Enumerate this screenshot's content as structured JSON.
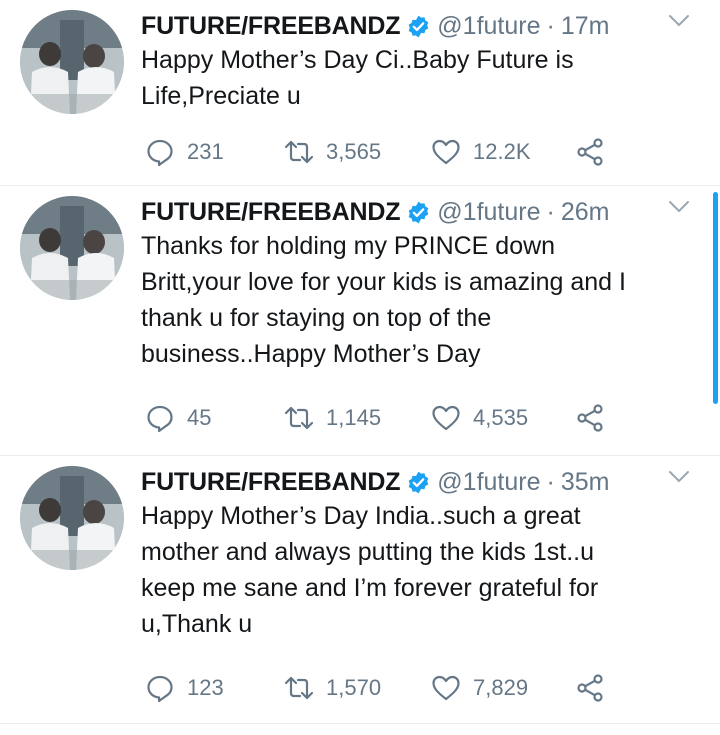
{
  "tweets": [
    {
      "name": "FUTURE/FREEBANDZ",
      "handle": "@1future",
      "separator": "·",
      "time": "17m",
      "lines": [
        "Happy Mother’s Day Ci..Baby Future is",
        "Life,Preciate u"
      ],
      "replies": "231",
      "retweets": "3,565",
      "likes": "12.2K"
    },
    {
      "name": "FUTURE/FREEBANDZ",
      "handle": "@1future",
      "separator": "·",
      "time": "26m",
      "lines": [
        "Thanks for holding my PRINCE down",
        "Britt,your love for your kids is amazing and I",
        "thank u for staying on top of the",
        "business..Happy Mother’s Day"
      ],
      "replies": "45",
      "retweets": "1,145",
      "likes": "4,535"
    },
    {
      "name": "FUTURE/FREEBANDZ",
      "handle": "@1future",
      "separator": "·",
      "time": "35m",
      "lines": [
        "Happy Mother’s Day India..such a great",
        "mother and always putting the kids 1st..u",
        "keep me sane and I’m forever grateful for",
        "u,Thank u"
      ],
      "replies": "123",
      "retweets": "1,570",
      "likes": "7,829"
    }
  ],
  "icons": {
    "verified": "verified-badge-icon",
    "caret": "chevron-down-icon",
    "reply": "reply-icon",
    "retweet": "retweet-icon",
    "like": "heart-icon",
    "share": "share-icon"
  },
  "colors": {
    "accent": "#1da1f2",
    "text": "#14171a",
    "secondary": "#657786",
    "divider": "#e6ecf0"
  }
}
